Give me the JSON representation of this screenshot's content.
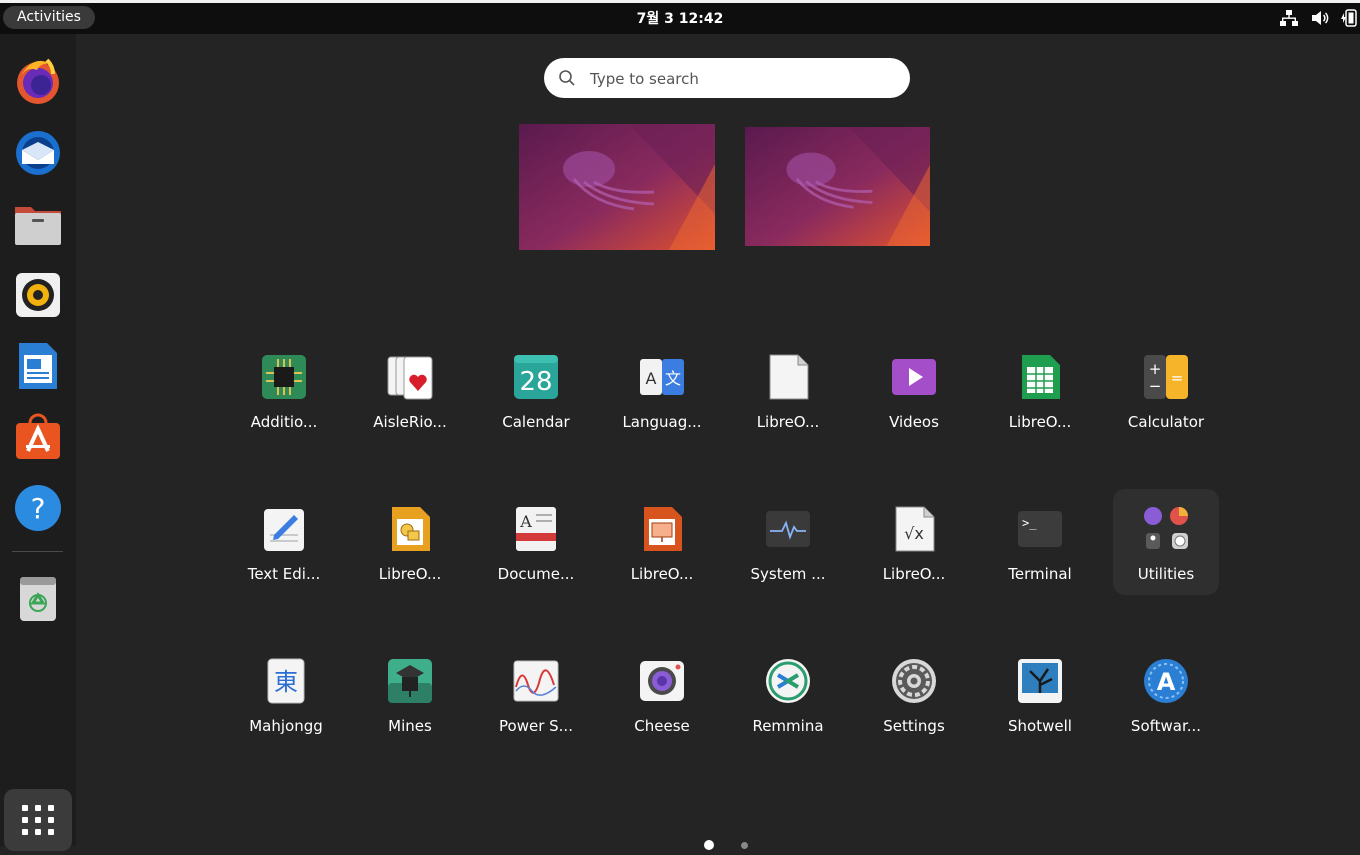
{
  "topbar": {
    "activities_label": "Activities",
    "clock": "7월 3  12:42",
    "tray_icons": [
      "network-icon",
      "volume-icon",
      "battery-icon"
    ]
  },
  "dock": {
    "items": [
      {
        "name": "firefox-icon"
      },
      {
        "name": "thunderbird-icon"
      },
      {
        "name": "files-icon"
      },
      {
        "name": "rhythmbox-icon"
      },
      {
        "name": "libreoffice-writer-icon"
      },
      {
        "name": "ubuntu-software-icon"
      },
      {
        "name": "help-icon"
      },
      {
        "name": "trash-icon"
      }
    ],
    "show_apps_icon": "grid-icon"
  },
  "search": {
    "placeholder": "Type to search"
  },
  "workspaces": [
    "workspace-1",
    "workspace-2"
  ],
  "apps": {
    "row1": [
      {
        "label": "Additio..."
      },
      {
        "label": "AisleRio..."
      },
      {
        "label": "Calendar",
        "icon_text": "28"
      },
      {
        "label": "Languag...",
        "icon_text_a": "A",
        "icon_text_b": "文"
      },
      {
        "label": "LibreO..."
      },
      {
        "label": "Videos"
      },
      {
        "label": "LibreO..."
      },
      {
        "label": "Calculator",
        "icon_text_a": "+",
        "icon_text_b": "−",
        "icon_text_c": "="
      }
    ],
    "row2": [
      {
        "label": "Text Edi..."
      },
      {
        "label": "LibreO..."
      },
      {
        "label": "Docume...",
        "icon_text": "A"
      },
      {
        "label": "LibreO..."
      },
      {
        "label": "System ..."
      },
      {
        "label": "LibreO...",
        "icon_text": "√x"
      },
      {
        "label": "Terminal",
        "icon_text": ">_"
      },
      {
        "label": "Utilities"
      }
    ],
    "row3": [
      {
        "label": "Mahjongg",
        "icon_text": "東"
      },
      {
        "label": "Mines"
      },
      {
        "label": "Power S..."
      },
      {
        "label": "Cheese"
      },
      {
        "label": "Remmina"
      },
      {
        "label": "Settings"
      },
      {
        "label": "Shotwell"
      },
      {
        "label": "Softwar...",
        "icon_text": "A"
      }
    ]
  },
  "pages": {
    "count": 2,
    "current": 1
  }
}
